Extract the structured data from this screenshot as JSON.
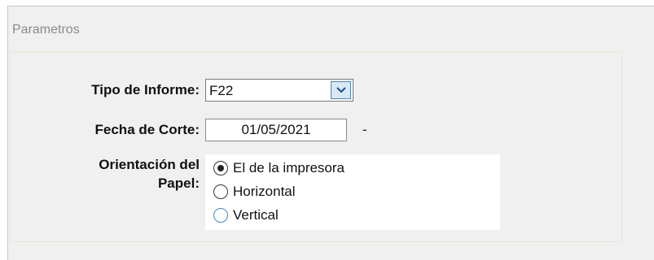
{
  "window": {
    "title": "Parametros"
  },
  "form": {
    "tipo_label": "Tipo de Informe:",
    "tipo_value": "F22",
    "fecha_label": "Fecha de Corte:",
    "fecha_value": "01/05/2021",
    "fecha_suffix": "-",
    "orientacion_label_1": "Orientación del",
    "orientacion_label_2": "Papel:",
    "orientacion_options": [
      {
        "label": "El de la impresora",
        "selected": true
      },
      {
        "label": "Horizontal",
        "selected": false
      },
      {
        "label": "Vertical",
        "selected": false
      }
    ]
  },
  "icons": {
    "dropdown": "chevron-down-icon",
    "radio": "radio-icon"
  },
  "colors": {
    "dropdown_button": "#d9e8f6",
    "focus": "#3b87d6"
  }
}
